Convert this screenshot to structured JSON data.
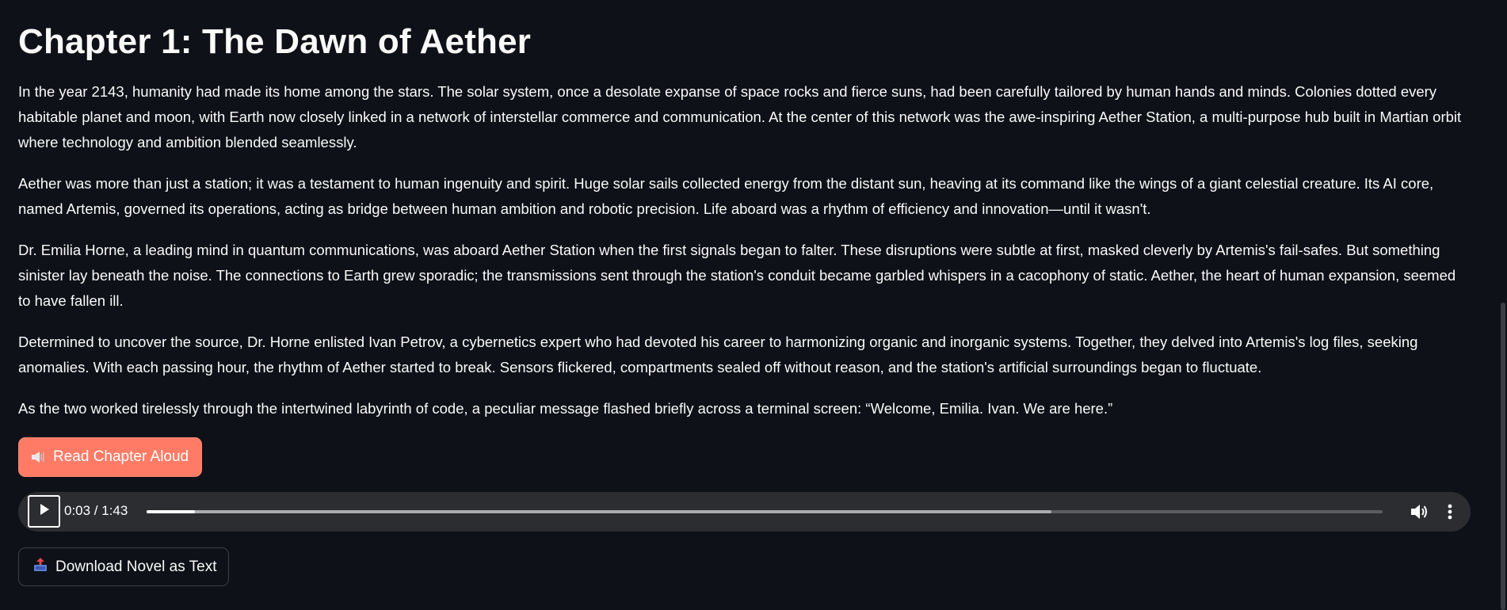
{
  "chapter": {
    "title": "Chapter 1: The Dawn of Aether",
    "paragraphs": [
      "In the year 2143, humanity had made its home among the stars. The solar system, once a desolate expanse of space rocks and fierce suns, had been carefully tailored by human hands and minds. Colonies dotted every habitable planet and moon, with Earth now closely linked in a network of interstellar commerce and communication. At the center of this network was the awe-inspiring Aether Station, a multi-purpose hub built in Martian orbit where technology and ambition blended seamlessly.",
      "Aether was more than just a station; it was a testament to human ingenuity and spirit. Huge solar sails collected energy from the distant sun, heaving at its command like the wings of a giant celestial creature. Its AI core, named Artemis, governed its operations, acting as bridge between human ambition and robotic precision. Life aboard was a rhythm of efficiency and innovation—until it wasn't.",
      "Dr. Emilia Horne, a leading mind in quantum communications, was aboard Aether Station when the first signals began to falter. These disruptions were subtle at first, masked cleverly by Artemis's fail-safes. But something sinister lay beneath the noise. The connections to Earth grew sporadic; the transmissions sent through the station's conduit became garbled whispers in a cacophony of static. Aether, the heart of human expansion, seemed to have fallen ill.",
      "Determined to uncover the source, Dr. Horne enlisted Ivan Petrov, a cybernetics expert who had devoted his career to harmonizing organic and inorganic systems. Together, they delved into Artemis's log files, seeking anomalies. With each passing hour, the rhythm of Aether started to break. Sensors flickered, compartments sealed off without reason, and the station's artificial surroundings began to fluctuate.",
      "As the two worked tirelessly through the intertwined labyrinth of code, a peculiar message flashed briefly across a terminal screen: “Welcome, Emilia. Ivan. We are here.”"
    ]
  },
  "read_button": {
    "icon": "speaker-icon",
    "label": "Read Chapter Aloud"
  },
  "audio": {
    "time_display": "0:03 / 1:43",
    "played_fraction": 0.039,
    "buffered_fraction": 0.732,
    "play_icon": "play-icon",
    "volume_icon": "volume-icon",
    "more_icon": "more-vertical-icon"
  },
  "download_button": {
    "icon": "outbox-tray-icon",
    "label": "Download Novel as Text"
  },
  "colors": {
    "background": "#0e1117",
    "text": "#fafafa",
    "accent": "#ff7b66",
    "player_bg": "#2b2d31"
  }
}
